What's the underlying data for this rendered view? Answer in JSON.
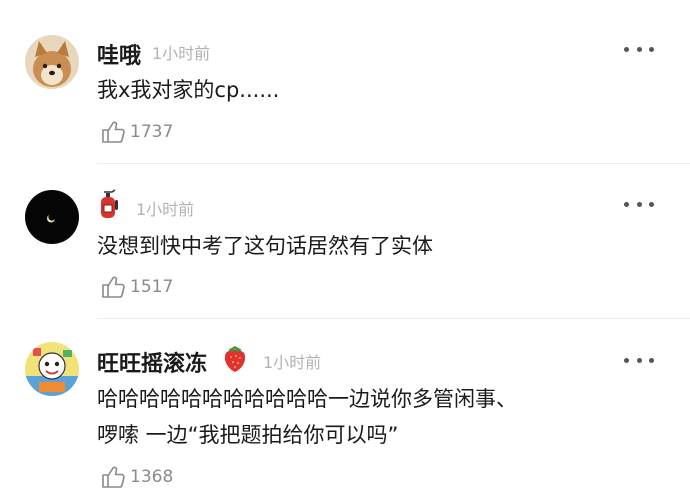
{
  "comments": [
    {
      "username": "哇哦",
      "time": "1小时前",
      "text": "我x我对家的cp......",
      "likes": "1737",
      "avatar_icon": "shiba-dog-avatar",
      "badge_icon": ""
    },
    {
      "username": "",
      "time": "1小时前",
      "text": "没想到快中考了这句话居然有了实体",
      "likes": "1517",
      "avatar_icon": "black-moon-avatar",
      "badge_icon": "fire-extinguisher-icon"
    },
    {
      "username": "旺旺摇滚冻",
      "time": "1小时前",
      "text_line1": "哈哈哈哈哈哈哈哈哈哈哈一边说你多管闲事、",
      "text_line2": "啰嗦 一边“我把题拍给你可以吗”",
      "likes": "1368",
      "avatar_icon": "cartoon-avatar",
      "badge_icon": "strawberry-icon"
    }
  ],
  "colors": {
    "text": "#1a1a1a",
    "time": "#b3b3b3",
    "likes": "#8a8a8a",
    "divider": "#ececec"
  }
}
